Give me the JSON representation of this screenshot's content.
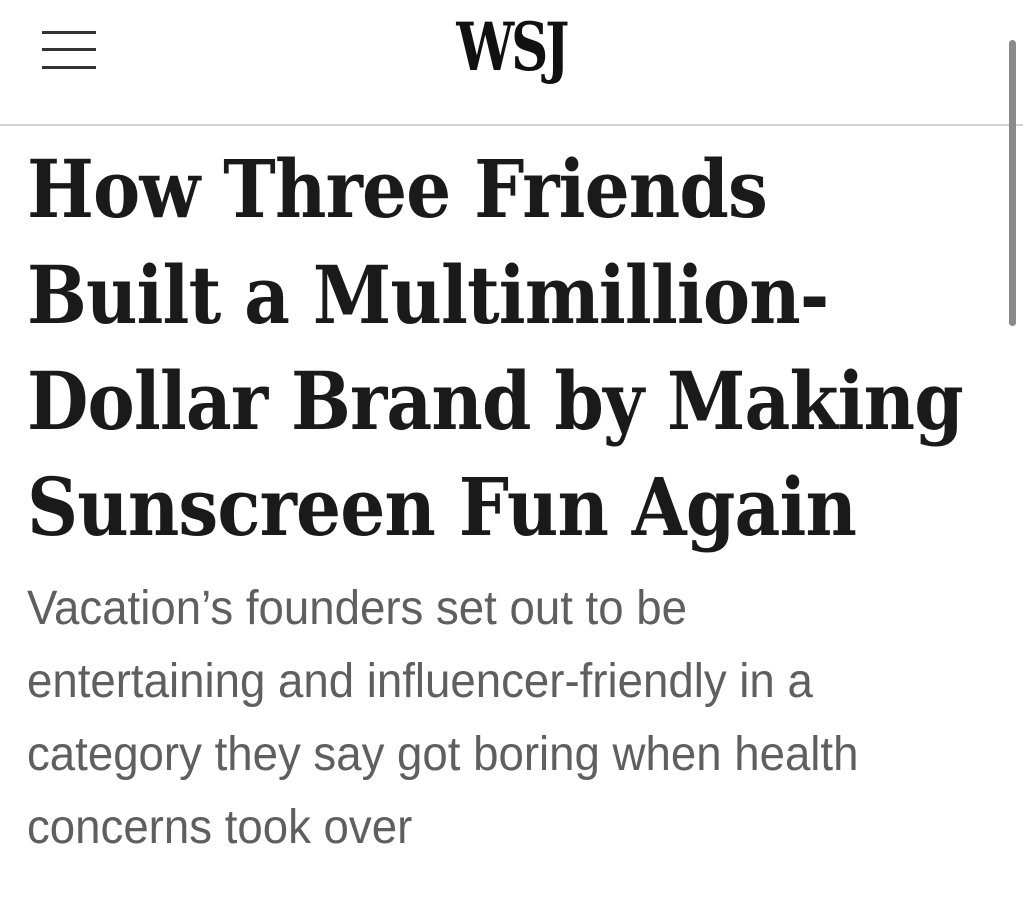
{
  "header": {
    "menu_icon": "hamburger-menu-icon",
    "logo": "WSJ"
  },
  "article": {
    "headline_lines": [
      "How Three Friends",
      "Built a Multimillion-",
      "Dollar Brand by Making",
      "Sunscreen Fun Again"
    ],
    "dek_lines": [
      "Vacation’s founders set out to be",
      "entertaining and influencer-friendly in a",
      "category they say got boring when health",
      "concerns took over"
    ]
  },
  "colors": {
    "headline": "#1a1a1a",
    "dek": "#5f5f5f",
    "divider": "#d2d2d2"
  }
}
